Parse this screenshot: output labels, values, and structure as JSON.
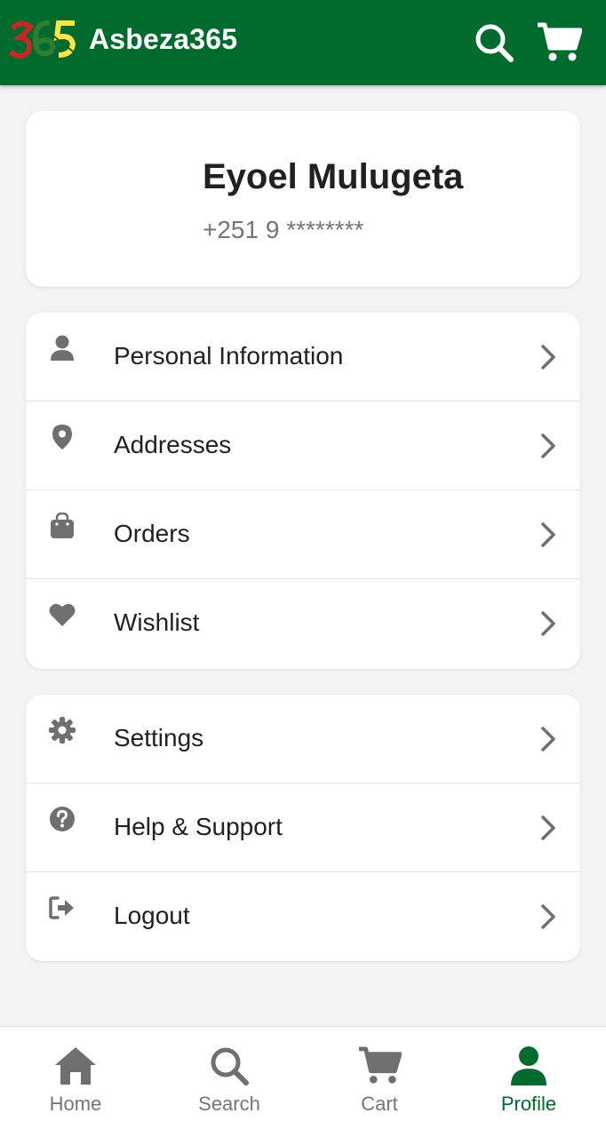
{
  "app": {
    "title": "Asbeza365"
  },
  "colors": {
    "primary": "#006b2c",
    "icon_gray": "#6f6f6f",
    "background": "#f3f3f3"
  },
  "appbar": {
    "icons": [
      "search-icon",
      "cart-icon"
    ]
  },
  "profile": {
    "name": "Eyoel Mulugeta",
    "phone": "+251 9 ********"
  },
  "menu_primary": [
    {
      "label": "Personal Information",
      "icon": "person-icon"
    },
    {
      "label": "Addresses",
      "icon": "location-pin-icon"
    },
    {
      "label": "Orders",
      "icon": "shopping-bag-icon"
    },
    {
      "label": "Wishlist",
      "icon": "heart-icon"
    }
  ],
  "menu_secondary": [
    {
      "label": "Settings",
      "icon": "gear-icon"
    },
    {
      "label": "Help & Support",
      "icon": "question-circle-icon"
    },
    {
      "label": "Logout",
      "icon": "logout-icon"
    }
  ],
  "bottom_nav": [
    {
      "label": "Home",
      "icon": "home-icon",
      "active": false
    },
    {
      "label": "Search",
      "icon": "search-icon",
      "active": false
    },
    {
      "label": "Cart",
      "icon": "cart-icon",
      "active": false
    },
    {
      "label": "Profile",
      "icon": "person-icon",
      "active": true
    }
  ]
}
